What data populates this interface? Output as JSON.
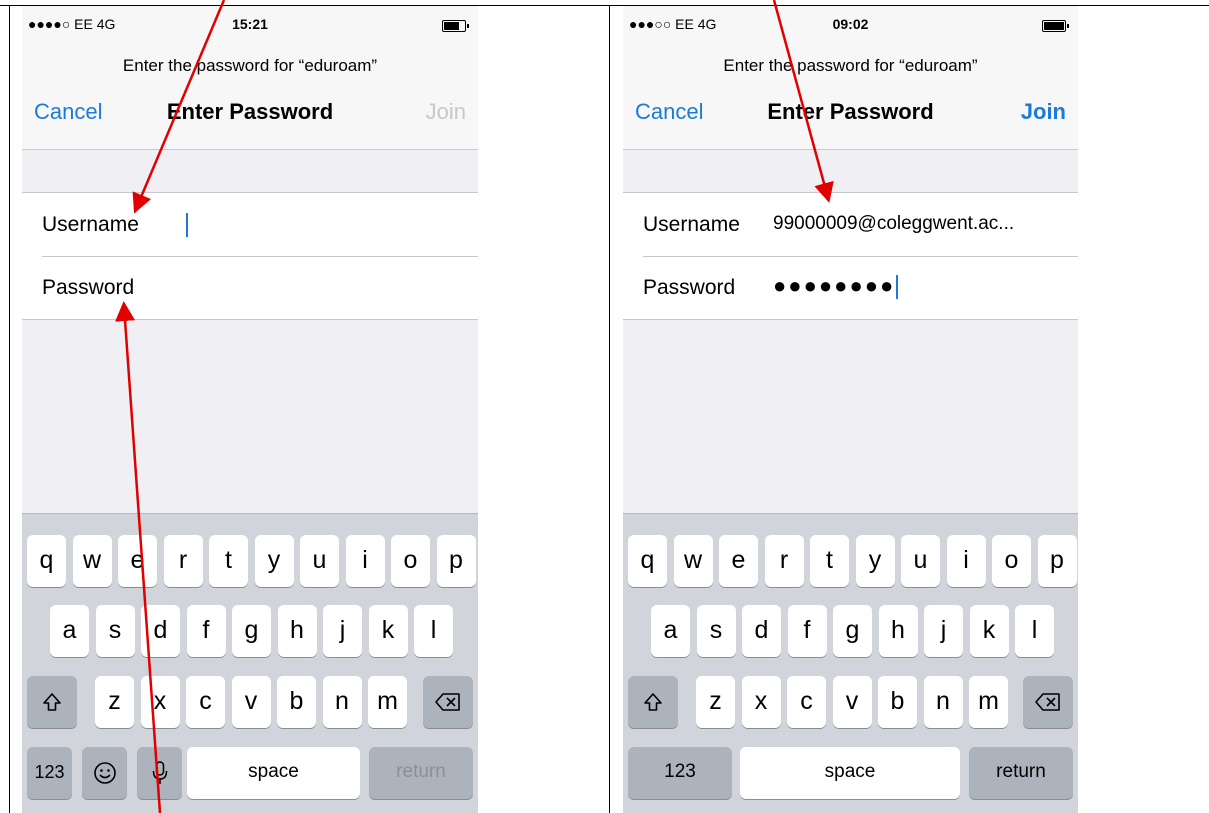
{
  "screens": [
    {
      "status": {
        "carrier": "●●●●○ EE  4G",
        "time": "15:21"
      },
      "prompt": "Enter the password for “eduroam”",
      "title": "Enter Password",
      "cancel": "Cancel",
      "join": "Join",
      "join_state": "disabled",
      "username_label": "Username",
      "username_value": "",
      "password_label": "Password",
      "password_value": "",
      "keyboard": {
        "row1": [
          "q",
          "w",
          "e",
          "r",
          "t",
          "y",
          "u",
          "i",
          "o",
          "p"
        ],
        "row2": [
          "a",
          "s",
          "d",
          "f",
          "g",
          "h",
          "j",
          "k",
          "l"
        ],
        "row3": [
          "z",
          "x",
          "c",
          "v",
          "b",
          "n",
          "m"
        ],
        "numbers": "123",
        "space": "space",
        "return": "return",
        "icons": [
          "shift-icon",
          "delete-icon",
          "emoji-icon",
          "microphone-icon"
        ]
      }
    },
    {
      "status": {
        "carrier": "●●●○○ EE  4G",
        "time": "09:02"
      },
      "prompt": "Enter the password for “eduroam”",
      "title": "Enter Password",
      "cancel": "Cancel",
      "join": "Join",
      "join_state": "enabled",
      "username_label": "Username",
      "username_value": "99000009@coleggwent.ac...",
      "password_label": "Password",
      "password_value": "●●●●●●●●",
      "keyboard": {
        "row1": [
          "q",
          "w",
          "e",
          "r",
          "t",
          "y",
          "u",
          "i",
          "o",
          "p"
        ],
        "row2": [
          "a",
          "s",
          "d",
          "f",
          "g",
          "h",
          "j",
          "k",
          "l"
        ],
        "row3": [
          "z",
          "x",
          "c",
          "v",
          "b",
          "n",
          "m"
        ],
        "numbers": "123",
        "space": "space",
        "return": "return",
        "icons": [
          "shift-icon",
          "delete-icon"
        ]
      }
    }
  ],
  "colors": {
    "accent": "#1e7ad8",
    "arrow": "#e00000",
    "keyboard_bg": "#d1d5db"
  }
}
